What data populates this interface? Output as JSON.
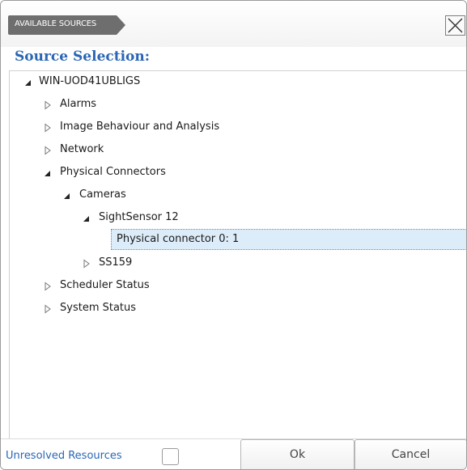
{
  "window": {
    "tab_label": "AVAILABLE SOURCES",
    "heading": "Source Selection:"
  },
  "tree": {
    "root": {
      "label": "WIN-UOD41UBLIGS",
      "expanded": true
    },
    "items": {
      "alarms": {
        "label": "Alarms",
        "expanded": false
      },
      "image_behaviour": {
        "label": "Image Behaviour and Analysis",
        "expanded": false
      },
      "network": {
        "label": "Network",
        "expanded": false
      },
      "physical_connectors": {
        "label": "Physical Connectors",
        "expanded": true
      },
      "cameras": {
        "label": "Cameras",
        "expanded": true
      },
      "sightsensor12": {
        "label": "SightSensor 12",
        "expanded": true
      },
      "physical_connector_0": {
        "label": "Physical connector 0: 1",
        "selected": true
      },
      "ss159": {
        "label": "SS159",
        "expanded": false
      },
      "scheduler_status": {
        "label": "Scheduler Status",
        "expanded": false
      },
      "system_status": {
        "label": "System Status",
        "expanded": false
      }
    }
  },
  "footer": {
    "unresolved_label": "Unresolved Resources",
    "unresolved_checked": false,
    "ok_label": "Ok",
    "cancel_label": "Cancel"
  },
  "icons": {
    "close": "close-x-icon",
    "expanded": "triangle-down-filled-icon",
    "collapsed": "triangle-right-outline-icon"
  },
  "colors": {
    "accent_blue": "#2a66b5",
    "tab_gray": "#6e6e6e",
    "selection_bg": "#dcecf9"
  }
}
